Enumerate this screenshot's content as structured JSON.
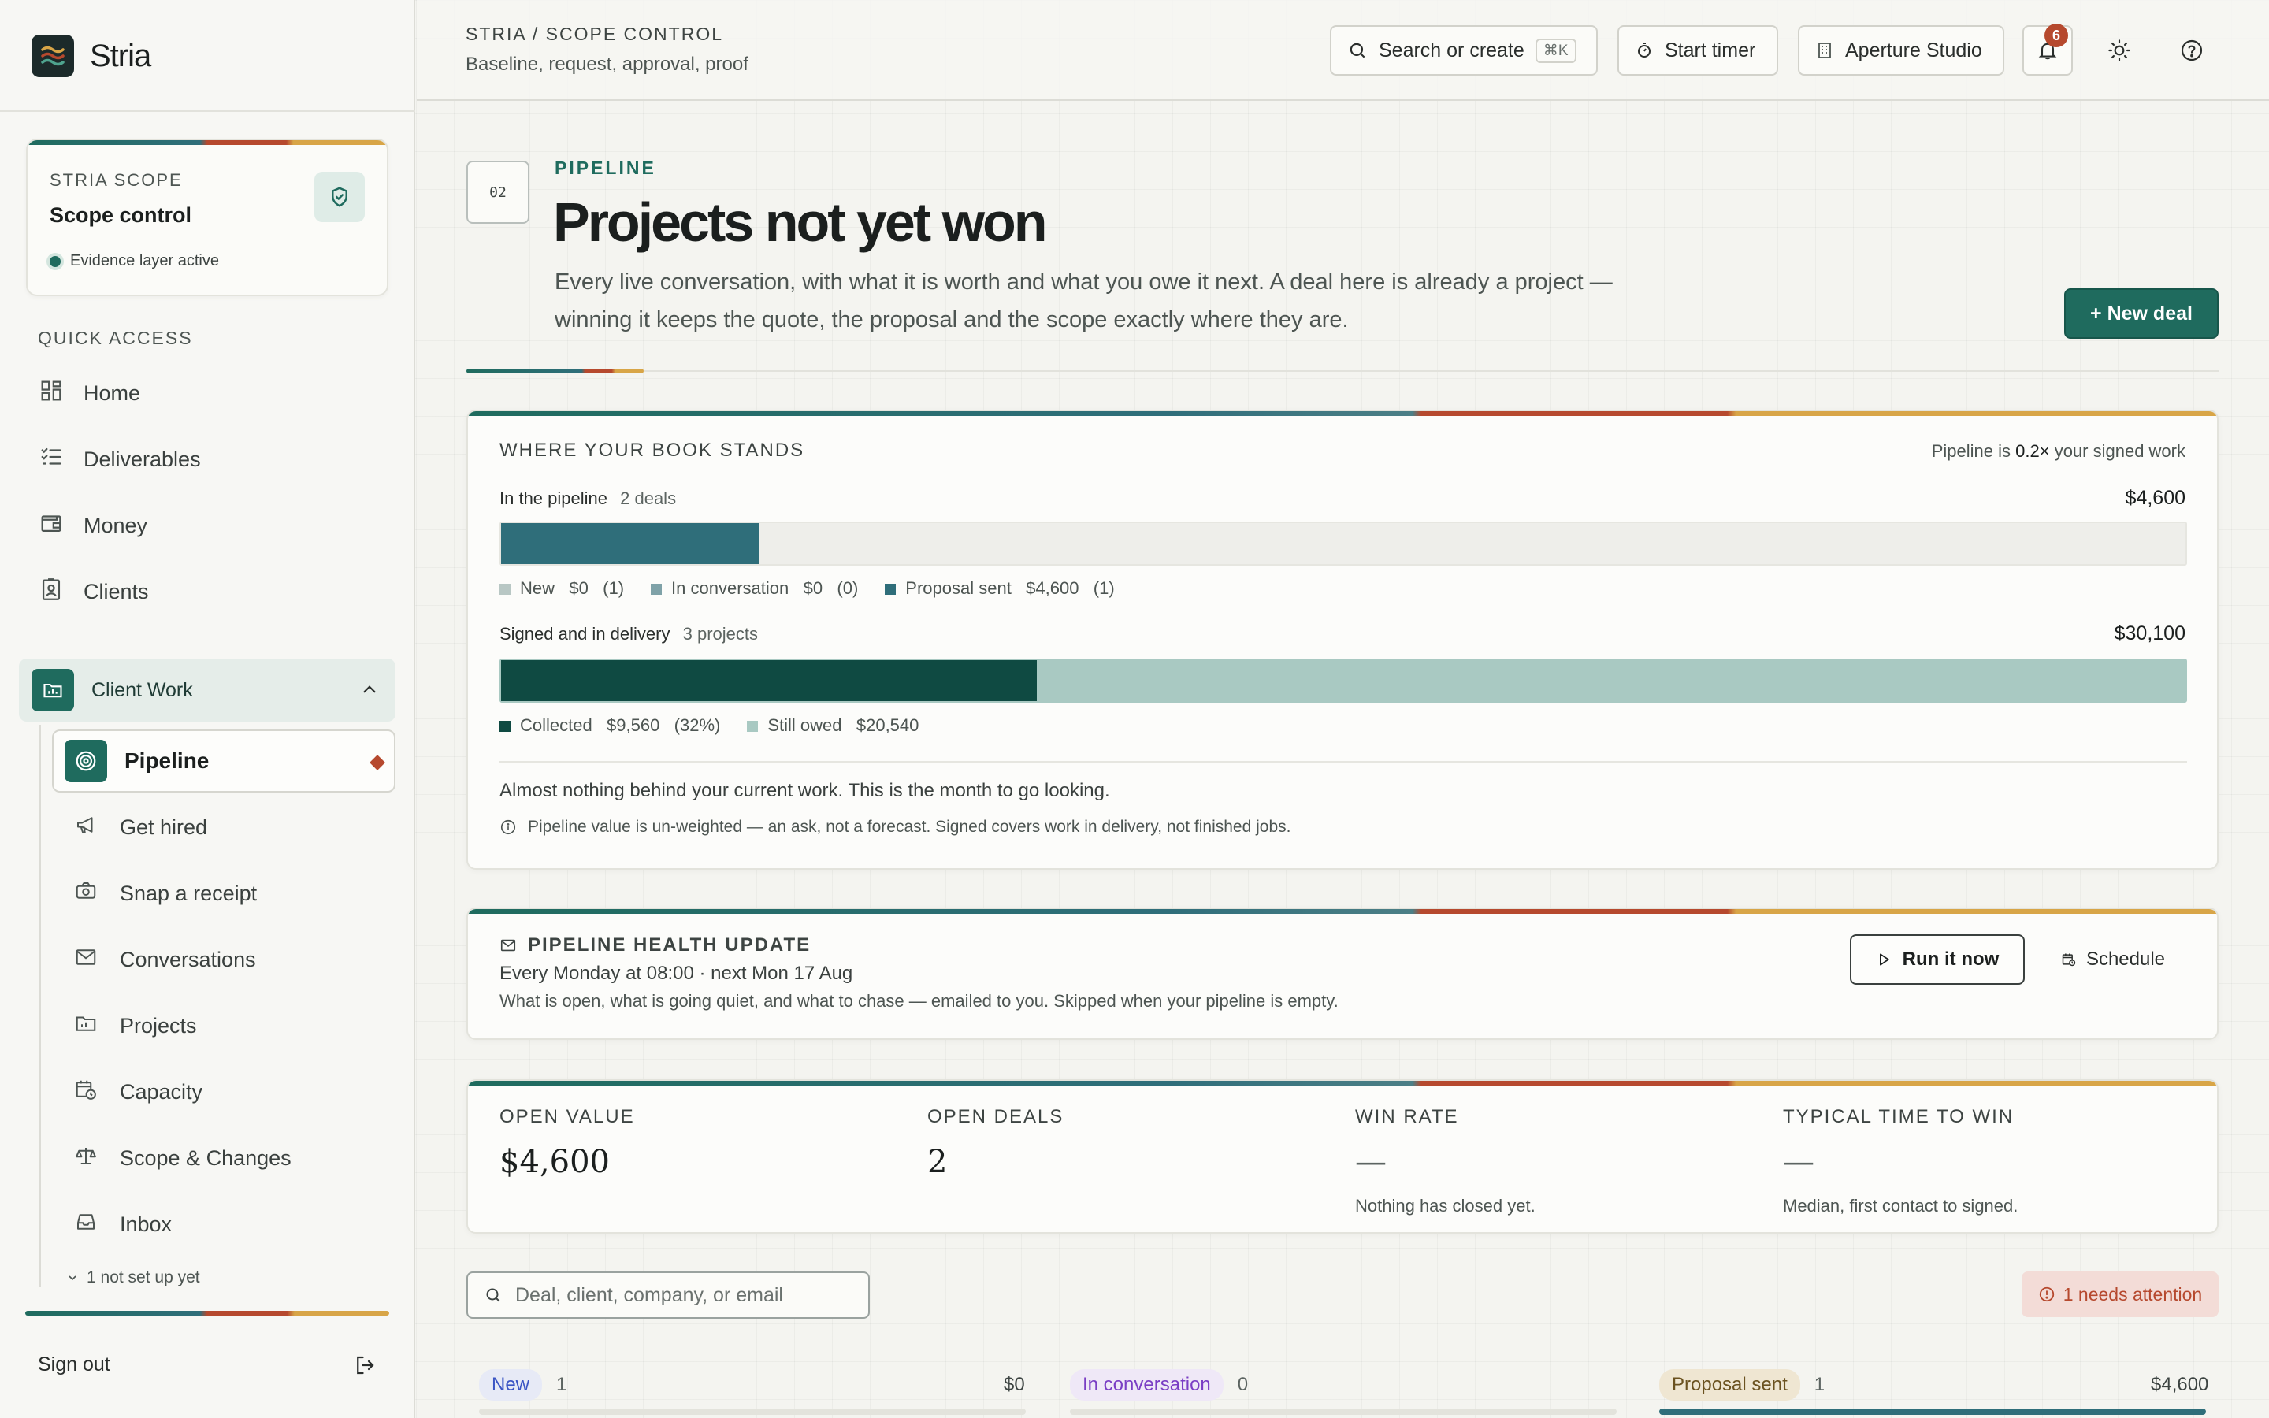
{
  "brand": {
    "name": "Stria"
  },
  "scope_card": {
    "eyebrow": "STRIA SCOPE",
    "title": "Scope control",
    "status": "Evidence layer active"
  },
  "sidebar": {
    "quick_access_label": "QUICK ACCESS",
    "quick_items": [
      {
        "label": "Home",
        "icon": "dashboard-icon"
      },
      {
        "label": "Deliverables",
        "icon": "checklist-icon"
      },
      {
        "label": "Money",
        "icon": "wallet-icon"
      },
      {
        "label": "Clients",
        "icon": "contact-badge-icon"
      }
    ],
    "group": {
      "label": "Client Work",
      "expanded": true
    },
    "active_item": "Pipeline",
    "sub_items": [
      {
        "label": "Get hired",
        "icon": "megaphone-icon"
      },
      {
        "label": "Snap a receipt",
        "icon": "camera-icon"
      },
      {
        "label": "Conversations",
        "icon": "mail-icon"
      },
      {
        "label": "Projects",
        "icon": "folder-chart-icon"
      },
      {
        "label": "Capacity",
        "icon": "calendar-clock-icon"
      },
      {
        "label": "Scope & Changes",
        "icon": "scale-icon"
      },
      {
        "label": "Inbox",
        "icon": "inbox-icon"
      }
    ],
    "more_setup": "1 not set up yet",
    "sign_out": "Sign out"
  },
  "topbar": {
    "breadcrumb": "STRIA / SCOPE CONTROL",
    "subtitle": "Baseline, request, approval, proof",
    "search_label": "Search or create",
    "search_shortcut": "⌘K",
    "timer_label": "Start timer",
    "workspace_label": "Aperture Studio",
    "notification_count": "6"
  },
  "header": {
    "section_number": "02",
    "eyebrow": "PIPELINE",
    "title": "Projects not yet won",
    "description": "Every live conversation, with what it is worth and what you owe it next. A deal here is already a project — winning it keeps the quote, the proposal and the scope exactly where they are.",
    "new_deal_label": "+ New deal"
  },
  "book": {
    "title": "WHERE YOUR BOOK STANDS",
    "ratio_prefix": "Pipeline is ",
    "ratio_value": "0.2×",
    "ratio_suffix": " your signed work",
    "pipeline_label": "In the pipeline",
    "pipeline_count": "2 deals",
    "pipeline_total": "$4,600",
    "pipeline_fraction": 0.153,
    "pipeline_legend": [
      {
        "text": "New   $0   (1)",
        "color": "#b8c7c4"
      },
      {
        "text": "In conversation   $0   (0)",
        "color": "#7fa2a8"
      },
      {
        "text": "Proposal sent   $4,600   (1)",
        "color": "#2f6e7a"
      }
    ],
    "signed_label": "Signed and in delivery",
    "signed_count": "3 projects",
    "signed_total": "$30,100",
    "collected_fraction": 0.318,
    "signed_legend": [
      {
        "text": "Collected   $9,560   (32%)",
        "color": "#0f4a42"
      },
      {
        "text": "Still owed   $20,540",
        "color": "#a9c9c2"
      }
    ],
    "summary": "Almost nothing behind your current work. This is the month to go looking.",
    "footnote": "Pipeline value is un-weighted — an ask, not a forecast. Signed covers work in delivery, not finished jobs."
  },
  "health": {
    "title": "PIPELINE HEALTH UPDATE",
    "schedule": "Every Monday at 08:00 · next Mon 17 Aug",
    "description": "What is open, what is going quiet, and what to chase — emailed to you. Skipped when your pipeline is empty.",
    "run_label": "Run it now",
    "schedule_label": "Schedule"
  },
  "stats": [
    {
      "label": "OPEN VALUE",
      "value": "$4,600",
      "note": ""
    },
    {
      "label": "OPEN DEALS",
      "value": "2",
      "note": ""
    },
    {
      "label": "WIN RATE",
      "value": "—",
      "note": "Nothing has closed yet."
    },
    {
      "label": "TYPICAL TIME TO WIN",
      "value": "—",
      "note": "Median, first contact to signed."
    }
  ],
  "filter": {
    "placeholder": "Deal, client, company, or email",
    "attention": "1 needs attention"
  },
  "columns": [
    {
      "label": "New",
      "count": "1",
      "amount": "$0",
      "color": "#3b55c4",
      "bg": "#e7eaf6"
    },
    {
      "label": "In conversation",
      "count": "0",
      "amount": "",
      "color": "#7a3ec4",
      "bg": "#efe8f7"
    },
    {
      "label": "Proposal sent",
      "count": "1",
      "amount": "$4,600",
      "color": "#6b5220",
      "bg": "#efe6d2"
    }
  ]
}
